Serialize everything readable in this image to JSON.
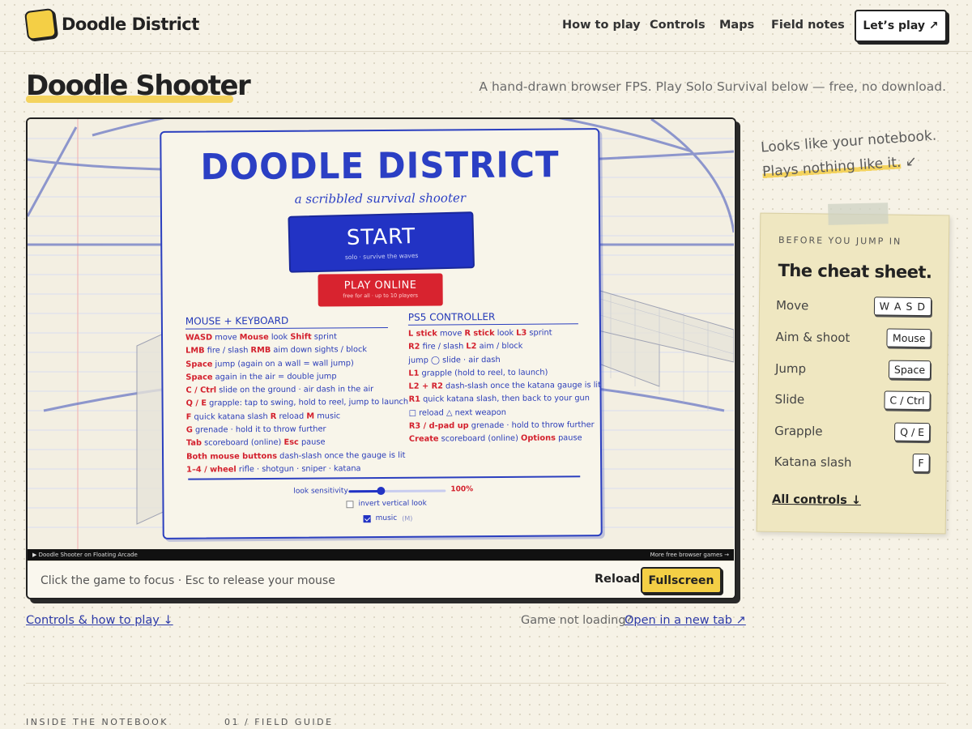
{
  "brand": {
    "name": "Doodle District"
  },
  "nav": {
    "items": [
      "How to play",
      "Controls",
      "Maps",
      "Field notes"
    ],
    "cta": "Let’s play ↗"
  },
  "page": {
    "title": "Doodle Shooter",
    "subtitle": "A hand-drawn browser FPS. Play Solo Survival below — free, no download."
  },
  "game": {
    "menu_title": "DOODLE DISTRICT",
    "menu_subtitle": "a scribbled survival shooter",
    "start_label": "START",
    "start_sub": "solo · survive the waves",
    "online_label": "PLAY ONLINE",
    "online_sub": "free for all · up to 10 players",
    "kb_heading": "MOUSE + KEYBOARD",
    "pad_heading": "PS5 CONTROLLER",
    "keyboard": [
      [
        [
          "WASD",
          "k"
        ],
        [
          " move  ",
          ""
        ],
        [
          "Mouse",
          "k"
        ],
        [
          " look  ",
          ""
        ],
        [
          "Shift",
          "k"
        ],
        [
          " sprint",
          ""
        ]
      ],
      [
        [
          "LMB",
          "k"
        ],
        [
          " fire / slash  ",
          ""
        ],
        [
          "RMB",
          "k"
        ],
        [
          " aim down sights / block",
          ""
        ]
      ],
      [
        [
          "Space",
          "k"
        ],
        [
          " jump (again on a wall = wall jump)",
          ""
        ]
      ],
      [
        [
          "Space",
          "k"
        ],
        [
          " again in the air = double jump",
          ""
        ]
      ],
      [
        [
          "C / Ctrl",
          "k"
        ],
        [
          " slide on the ground · air dash in the air",
          ""
        ]
      ],
      [
        [
          "Q / E",
          "k"
        ],
        [
          " grapple: tap to swing, hold to reel, jump to launch",
          ""
        ]
      ],
      [
        [
          "F",
          "k"
        ],
        [
          " quick katana slash  ",
          ""
        ],
        [
          "R",
          "k"
        ],
        [
          " reload  ",
          ""
        ],
        [
          "M",
          "k"
        ],
        [
          " music",
          ""
        ]
      ],
      [
        [
          "G",
          "k"
        ],
        [
          " grenade · hold it to throw further",
          ""
        ]
      ],
      [
        [
          "Tab",
          "k"
        ],
        [
          " scoreboard (online)  ",
          ""
        ],
        [
          "Esc",
          "k"
        ],
        [
          " pause",
          ""
        ]
      ],
      [
        [
          "Both mouse buttons",
          "k"
        ],
        [
          " dash-slash once the gauge is lit",
          ""
        ]
      ],
      [
        [
          "1–4 / wheel",
          "k"
        ],
        [
          " rifle · shotgun · sniper · katana",
          ""
        ]
      ]
    ],
    "controller": [
      [
        [
          "L stick",
          "k"
        ],
        [
          " move  ",
          ""
        ],
        [
          "R stick",
          "k"
        ],
        [
          " look  ",
          ""
        ],
        [
          "L3",
          "k"
        ],
        [
          " sprint",
          ""
        ]
      ],
      [
        [
          "R2",
          "k"
        ],
        [
          " fire / slash  ",
          ""
        ],
        [
          "L2",
          "k"
        ],
        [
          " aim / block",
          ""
        ]
      ],
      [
        [
          "  jump  ◯",
          ""
        ],
        [
          " slide · air dash",
          ""
        ]
      ],
      [
        [
          "L1",
          "k"
        ],
        [
          " grapple (hold to reel,   to launch)",
          ""
        ]
      ],
      [
        [
          "L2 + R2",
          "k"
        ],
        [
          " dash-slash once the katana gauge is lit",
          ""
        ]
      ],
      [
        [
          "R1",
          "k"
        ],
        [
          " quick katana slash, then back to your gun",
          ""
        ]
      ],
      [
        [
          "□",
          ""
        ],
        [
          " reload  △ next weapon",
          ""
        ]
      ],
      [
        [
          "R3 / d-pad up",
          "k"
        ],
        [
          " grenade · hold to throw further",
          ""
        ]
      ],
      [
        [
          "Create",
          "k"
        ],
        [
          " scoreboard (online)  ",
          ""
        ],
        [
          "Options",
          "k"
        ],
        [
          " pause",
          ""
        ]
      ]
    ],
    "sensitivity_label": "look sensitivity",
    "sensitivity_value": "100%",
    "sensitivity_fraction": 0.33,
    "invert_label": "invert vertical look",
    "invert_checked": false,
    "music_label": "music",
    "music_hint": "(M)",
    "music_checked": true,
    "status_left": "▶ Doodle Shooter on Floating Arcade",
    "status_right": "More free browser games →",
    "focus_hint": "Click the game to focus · Esc to release your mouse",
    "reload_label": "Reload",
    "fullscreen_label": "Fullscreen"
  },
  "below_frame": {
    "controls_link": "Controls & how to play ↓",
    "not_loading": "Game not loading?",
    "new_tab_link": "Open in a new tab ↗"
  },
  "sidebar": {
    "note_line1": "Looks like your notebook.",
    "note_line2": "Plays nothing like it.",
    "note_arrow": "↙",
    "kicker": "BEFORE YOU JUMP IN",
    "title": "The cheat sheet.",
    "rows": [
      {
        "label": "Move",
        "key": "W A S D"
      },
      {
        "label": "Aim & shoot",
        "key": "Mouse"
      },
      {
        "label": "Jump",
        "key": "Space"
      },
      {
        "label": "Slide",
        "key": "C / Ctrl"
      },
      {
        "label": "Grapple",
        "key": "Q / E"
      },
      {
        "label": "Katana slash",
        "key": "F"
      }
    ],
    "all_controls": "All controls ↓"
  },
  "footer": {
    "eyebrow_left": "INSIDE THE NOTEBOOK",
    "eyebrow_right": "01 / FIELD GUIDE"
  },
  "colors": {
    "accent": "#f4cf45",
    "ink_blue": "#2233c4",
    "ink_red": "#d8232f"
  }
}
